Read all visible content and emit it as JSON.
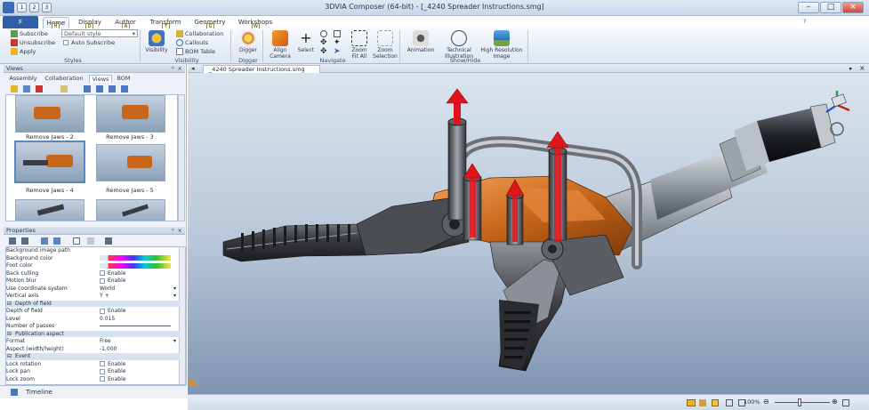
{
  "window": {
    "title": "3DVIA Composer (64-bit) - [_4240 Spreader Instructions.smg]",
    "help": "?",
    "minimize": "–",
    "maximize": "□",
    "close": "×"
  },
  "quick_access": {
    "keys": [
      "1",
      "2",
      "3"
    ]
  },
  "file_button": {
    "label": "F"
  },
  "tabs": [
    {
      "label": "Home",
      "key": "H",
      "active": true
    },
    {
      "label": "Display",
      "key": "D"
    },
    {
      "label": "Author",
      "key": "A"
    },
    {
      "label": "Transform",
      "key": "T"
    },
    {
      "label": "Geometry",
      "key": "G"
    },
    {
      "label": "Workshops",
      "key": "W"
    }
  ],
  "ribbon": {
    "styles": {
      "subscribe": "Subscribe",
      "style_value": "Default style",
      "unsubscribe": "Unsubscribe",
      "auto_subscribe": "Auto Subscribe",
      "apply": "Apply",
      "group": "Styles"
    },
    "visibility": {
      "visibility": "Visibility",
      "collaboration": "Collaboration",
      "callouts": "Callouts",
      "bom_table": "BOM Table",
      "group": "Visibility"
    },
    "digger": {
      "label": "Digger",
      "group": "Digger"
    },
    "navigate": {
      "align_camera": "Align Camera",
      "select": "Select",
      "zoom_fit_all": "Zoom Fit All",
      "zoom_selection": "Zoom Selection",
      "group": "Navigate"
    },
    "showhide": {
      "animation": "Animation",
      "technical_illustration": "Technical Illustration",
      "high_res_image": "High Resolution Image",
      "group": "Show/Hide"
    }
  },
  "views_panel": {
    "title": "Views",
    "tabs": [
      "Assembly",
      "Collaboration",
      "Views",
      "BOM"
    ],
    "active_tab": "Views",
    "thumbnails": [
      {
        "caption": "Remove Jaws - 2"
      },
      {
        "caption": "Remove Jaws - 3"
      },
      {
        "caption": "Remove Jaws - 4",
        "selected": true
      },
      {
        "caption": "Remove Jaws - 5"
      },
      {
        "caption": ""
      },
      {
        "caption": ""
      }
    ]
  },
  "properties_panel": {
    "title": "Properties",
    "rows": [
      {
        "name": "Background image path",
        "value": ""
      },
      {
        "name": "Background color",
        "value": ""
      },
      {
        "name": "Foot color",
        "value": ""
      },
      {
        "name": "Back culling",
        "value": "Enable",
        "check": true
      },
      {
        "name": "Motion blur",
        "value": "Enable",
        "check": true
      },
      {
        "name": "Use coordinate system",
        "value": "World",
        "dropdown": true
      },
      {
        "name": "Vertical axis",
        "value": "Y +",
        "dropdown": true
      },
      {
        "name": "Depth of field",
        "category": true
      },
      {
        "name": "Depth of field",
        "value": "Enable",
        "check": true
      },
      {
        "name": "Level",
        "value": "0.015"
      },
      {
        "name": "Number of passes",
        "value": ""
      },
      {
        "name": "Publication aspect",
        "category": true
      },
      {
        "name": "Format",
        "value": "Free",
        "dropdown": true
      },
      {
        "name": "Aspect (width/height)",
        "value": "-1.000"
      },
      {
        "name": "Event",
        "category": true
      },
      {
        "name": "Lock rotation",
        "value": "Enable",
        "check": true
      },
      {
        "name": "Lock pan",
        "value": "Enable",
        "check": true
      },
      {
        "name": "Lock zoom",
        "value": "Enable",
        "check": true
      }
    ]
  },
  "timeline": {
    "label": "Timeline"
  },
  "document_tab": {
    "label": "_4240 Spreader Instructions.smg"
  },
  "statusbar": {
    "zoom": "100%"
  },
  "colors": {
    "accent": "#2f5fa7",
    "arrow_red": "#e0141b",
    "body_orange": "#c8661a",
    "jaw_dark": "#3a3c40"
  }
}
